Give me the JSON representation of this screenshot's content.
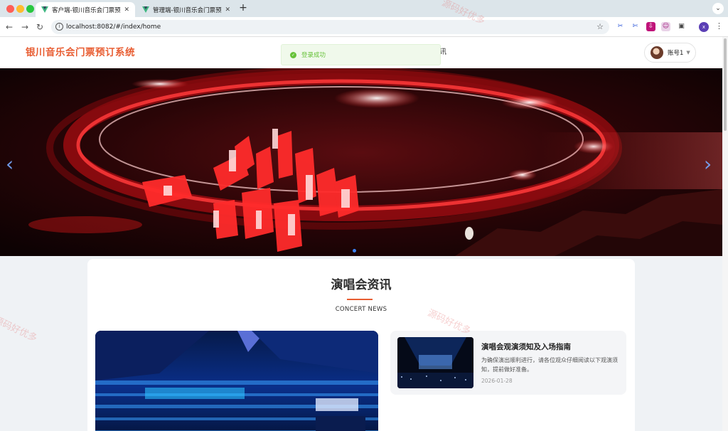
{
  "browser": {
    "tabs": [
      {
        "title": "客户端-银川音乐会门票预订系统",
        "active": true
      },
      {
        "title": "管理端-银川音乐会门票预订系统",
        "active": false
      }
    ],
    "new_tab_icon": "plus-icon",
    "url": "localhost:8082/#/index/home",
    "profile_initial": "x"
  },
  "header": {
    "site_title": "银川音乐会门票预订系统",
    "nav_fragment": "讯",
    "account_name": "账号1"
  },
  "toast": {
    "text": "登录成功",
    "status_color": "#67c23a"
  },
  "banner": {
    "prev_glyph": "‹",
    "next_glyph": "›",
    "active_slide": 1,
    "slide_count": 1
  },
  "news": {
    "title": "演唱会资讯",
    "subtitle": "CONCERT NEWS",
    "items": [
      {
        "title": "演唱会观演须知及入场指南",
        "description": "为确保演出顺利进行，请各位观众仔细阅读以下观演须知，提前做好准备。",
        "date": "2026-01-28"
      }
    ]
  },
  "watermarks": [
    "源码好优多",
    "源码好优多",
    "源码好优多"
  ],
  "colors": {
    "brand": "#e85d32",
    "success": "#67c23a",
    "indicator": "#3b82f6"
  }
}
